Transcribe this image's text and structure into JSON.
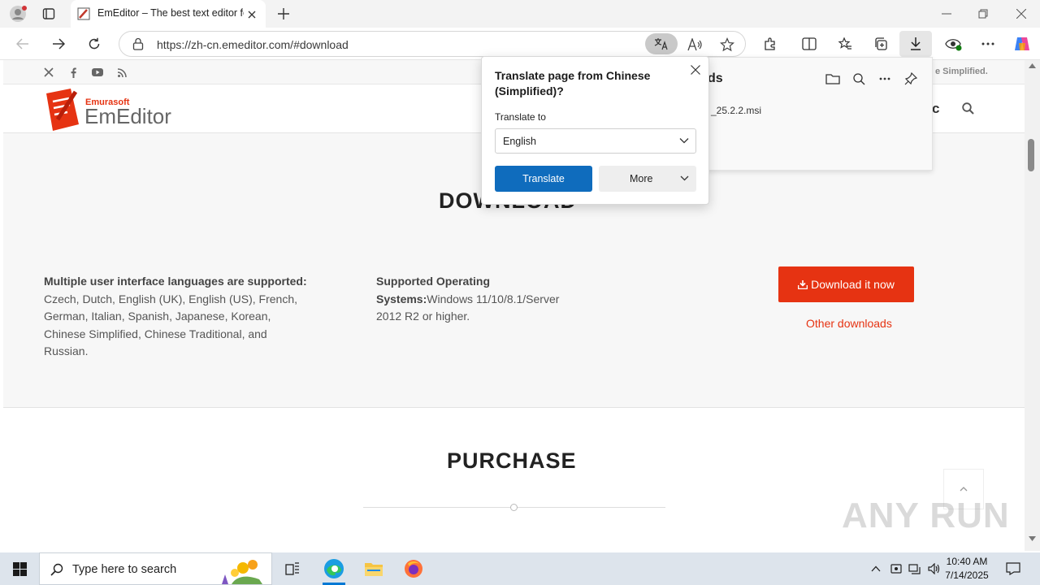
{
  "browser": {
    "tab": {
      "title": "EmEditor – The best text editor fo"
    },
    "url": "https://zh-cn.emeditor.com/#download"
  },
  "page": {
    "logo": {
      "brand": "Emurasoft",
      "name": "EmEditor"
    },
    "header_partial_text": "c",
    "social_partial_text": "e Simplified.",
    "download_heading": "DOWNLOAD",
    "languages": {
      "label": "Multiple user interface languages are supported:",
      "text": "Czech, Dutch, English (UK), English (US), French, German, Italian, Spanish, Japanese, Korean, Chinese Simplified, Chinese Traditional, and Russian."
    },
    "os": {
      "label": "Supported Operating Systems:",
      "text": "Windows 11/10/8.1/Server 2012 R2 or higher."
    },
    "download_button": "Download it now",
    "other_downloads": "Other downloads",
    "purchase_heading": "PURCHASE"
  },
  "downloads_panel": {
    "title_partial": "ds",
    "file_partial": "_25.2.2.msi"
  },
  "translate_popup": {
    "title": "Translate page from Chinese (Simplified)?",
    "translate_to_label": "Translate to",
    "selected_language": "English",
    "translate_button": "Translate",
    "more_button": "More"
  },
  "taskbar": {
    "search_placeholder": "Type here to search",
    "time": "10:40 AM",
    "date": "7/14/2025"
  },
  "watermark": "ANY RUN",
  "colors": {
    "accent_red": "#e63312",
    "translate_blue": "#0f6cbd"
  }
}
